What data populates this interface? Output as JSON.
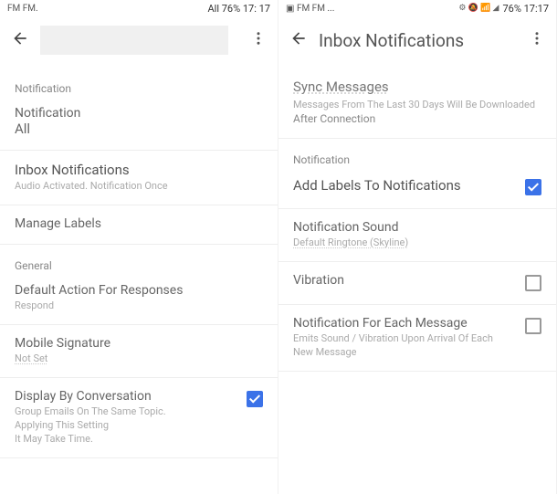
{
  "left": {
    "status": {
      "left": "FM FM.",
      "right": "All 76% 17: 17"
    },
    "sections": {
      "notif1_label": "Notification",
      "notif2_label": "Notification",
      "notif_value": "All",
      "inbox_title": "Inbox Notifications",
      "inbox_sub": "Audio Activated. Notification Once",
      "manage_labels": "Manage Labels",
      "general": "General",
      "default_action": "Default Action For Responses",
      "default_action_sub": "Respond",
      "mobile_sig": "Mobile Signature",
      "mobile_sig_sub": "Not Set",
      "display_conv": "Display By Conversation",
      "display_conv_sub1": "Group Emails On The Same Topic.",
      "display_conv_sub2": "Applying This Setting",
      "display_conv_sub3": "It May Take Time."
    }
  },
  "right": {
    "status": {
      "left": "FM FM ...",
      "icons": "⚙ 🔕 📶 ◢",
      "pct": "76% 17:17"
    },
    "title": "Inbox Notifications",
    "sync": {
      "title": "Sync Messages",
      "sub1": "Messages From The Last 30 Days Will Be Downloaded",
      "sub2": "After Connection"
    },
    "notif_label": "Notification",
    "add_labels": "Add Labels To Notifications",
    "sound_title": "Notification Sound",
    "sound_sub": "Default Ringtone (Skyline)",
    "vibration": "Vibration",
    "each_title": "Notification For Each Message",
    "each_sub1": "Emits Sound / Vibration Upon Arrival Of Each",
    "each_sub2": "New Message"
  }
}
